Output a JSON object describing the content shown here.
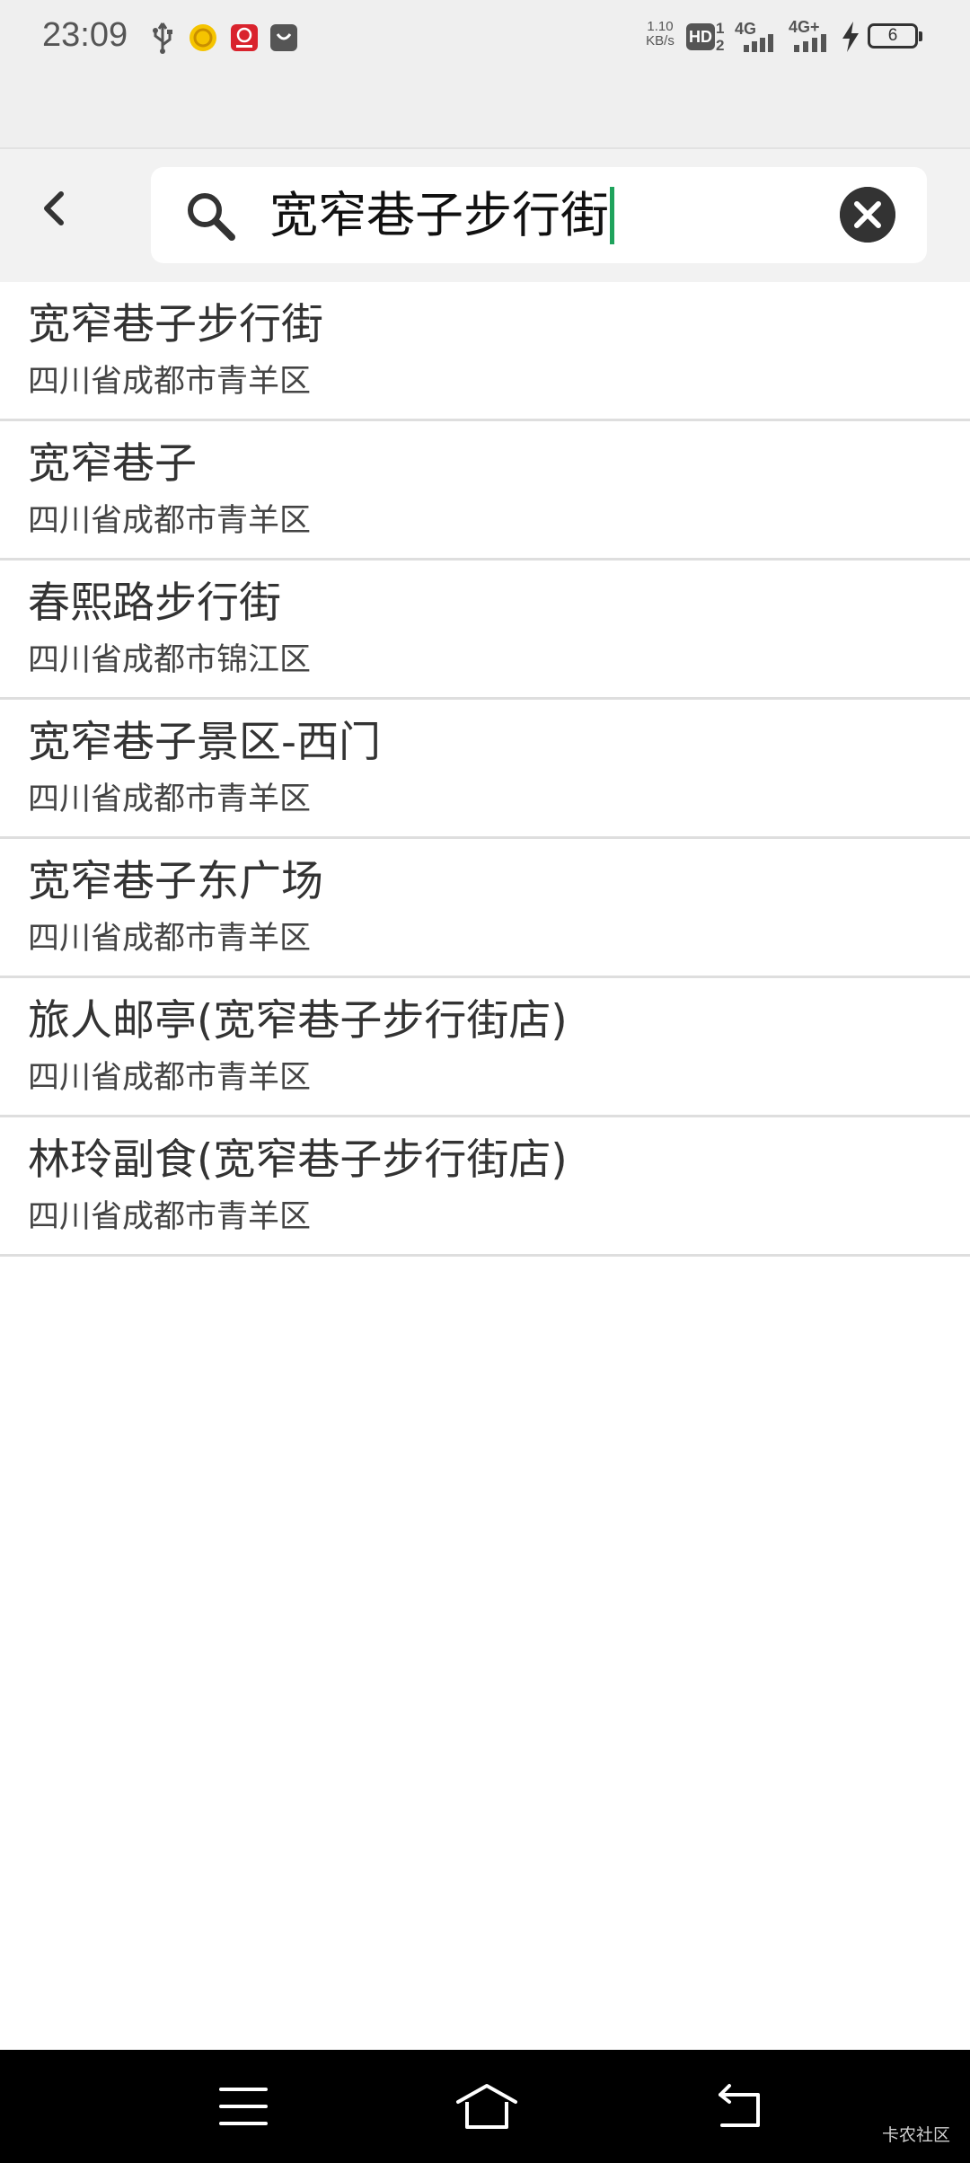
{
  "status_bar": {
    "time": "23:09",
    "net_speed_value": "1.10",
    "net_speed_unit": "KB/s",
    "hd_label": "HD",
    "sim1": "1",
    "sim2": "2",
    "network_1": "4G",
    "network_2": "4G+",
    "battery_level": "6",
    "icons": [
      "usb-icon",
      "coin-app-icon",
      "red-app-icon",
      "shopping-bag-icon",
      "signal-icon",
      "charging-icon"
    ]
  },
  "search": {
    "query": "宽窄巷子步行街",
    "caret_color": "#1fa35c"
  },
  "results": [
    {
      "title": "宽窄巷子步行街",
      "subtitle": "四川省成都市青羊区"
    },
    {
      "title": "宽窄巷子",
      "subtitle": "四川省成都市青羊区"
    },
    {
      "title": "春熙路步行街",
      "subtitle": "四川省成都市锦江区"
    },
    {
      "title": "宽窄巷子景区-西门",
      "subtitle": "四川省成都市青羊区"
    },
    {
      "title": "宽窄巷子东广场",
      "subtitle": "四川省成都市青羊区"
    },
    {
      "title": "旅人邮亭(宽窄巷子步行街店)",
      "subtitle": "四川省成都市青羊区"
    },
    {
      "title": "林玲副食(宽窄巷子步行街店)",
      "subtitle": "四川省成都市青羊区"
    }
  ],
  "nav": {
    "icons": [
      "menu-icon",
      "home-icon",
      "back-nav-icon"
    ]
  },
  "watermark": "卡农社区"
}
